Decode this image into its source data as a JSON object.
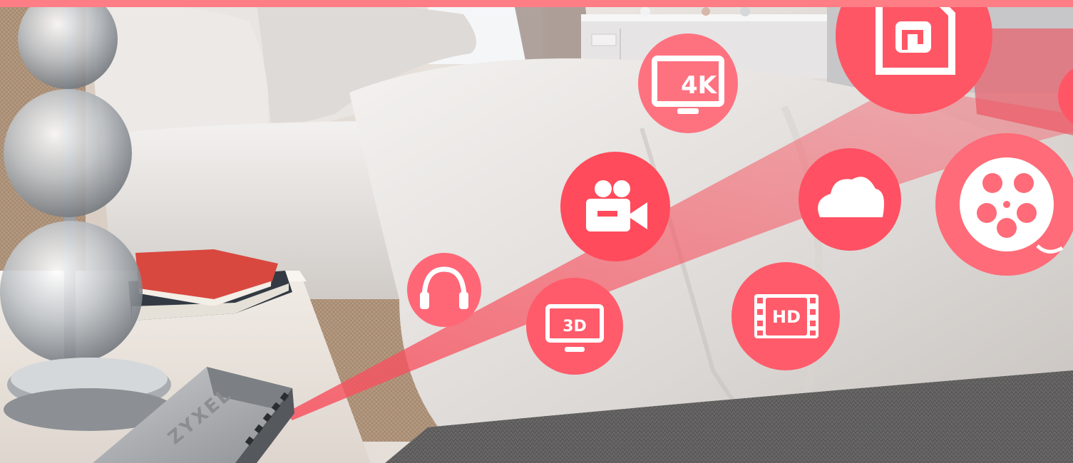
{
  "colors": {
    "accent": "#ff6b7a",
    "accent_dark": "#f8515f",
    "beam": "#f8515f",
    "icon_fg": "#ffffff",
    "stripe": "#ff7d85"
  },
  "switch": {
    "brand": "ZYXEL"
  },
  "icons": [
    {
      "name": "monitor-4k-icon",
      "label": "4K"
    },
    {
      "name": "music-file-icon",
      "label": ""
    },
    {
      "name": "video-camera-icon",
      "label": ""
    },
    {
      "name": "cloud-icon",
      "label": ""
    },
    {
      "name": "film-reel-icon",
      "label": ""
    },
    {
      "name": "headphones-icon",
      "label": ""
    },
    {
      "name": "monitor-3d-icon",
      "label": "3D"
    },
    {
      "name": "hd-film-icon",
      "label": "HD"
    }
  ]
}
